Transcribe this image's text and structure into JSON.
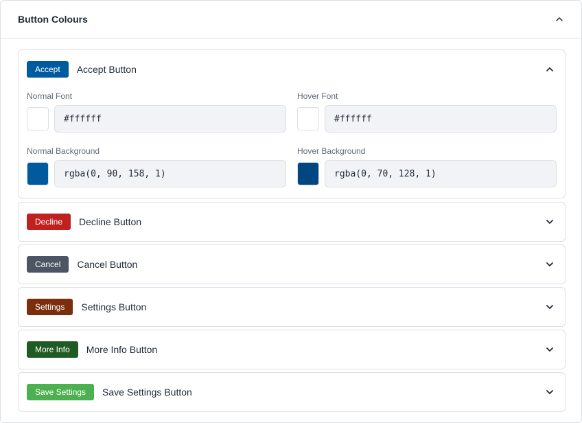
{
  "panel": {
    "title": "Button Colours",
    "icon": "chevron-up-icon"
  },
  "accept": {
    "badge": "Accept",
    "label": "Accept Button",
    "badge_color": "#005a9e",
    "fields": {
      "normal_font": {
        "label": "Normal Font",
        "value": "#ffffff",
        "swatch": "#ffffff"
      },
      "hover_font": {
        "label": "Hover Font",
        "value": "#ffffff",
        "swatch": "#ffffff"
      },
      "normal_bg": {
        "label": "Normal Background",
        "value": "rgba(0, 90, 158, 1)",
        "swatch": "#005a9e"
      },
      "hover_bg": {
        "label": "Hover Background",
        "value": "rgba(0, 70, 128, 1)",
        "swatch": "#004680"
      }
    }
  },
  "sections": [
    {
      "badge": "Decline",
      "label": "Decline Button",
      "badge_color": "#c0211f"
    },
    {
      "badge": "Cancel",
      "label": "Cancel Button",
      "badge_color": "#4b5563"
    },
    {
      "badge": "Settings",
      "label": "Settings Button",
      "badge_color": "#7a2e0c"
    },
    {
      "badge": "More Info",
      "label": "More Info Button",
      "badge_color": "#1f5c24"
    },
    {
      "badge": "Save Settings",
      "label": "Save Settings Button",
      "badge_color": "#4caf50"
    }
  ]
}
